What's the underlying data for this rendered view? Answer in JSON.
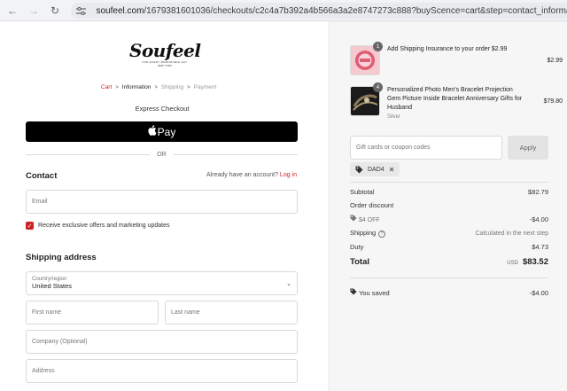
{
  "browser": {
    "url_host": "soufeel.com",
    "url_path": "/1679381601036/checkouts/c2c4a7b392a4b566a3a2e8747273c888?buyScence=cart&step=contact_information"
  },
  "brand": {
    "name": "Soufeel",
    "tagline": "FOR EVERY MEMORABLE DAY",
    "tagline2": "NEW YORK",
    "accent": "#cc2222"
  },
  "breadcrumb": {
    "cart": "Cart",
    "information": "Information",
    "shipping": "Shipping",
    "payment": "Payment",
    "separator": ">"
  },
  "express": {
    "title": "Express Checkout",
    "applepay_label": "Pay",
    "or_label": "OR"
  },
  "contact": {
    "title": "Contact",
    "account_prompt": "Already have an account?",
    "login_label": "Log in",
    "email_placeholder": "Email",
    "offers_label": "Receive exclusive offers and marketing updates"
  },
  "shipping": {
    "title": "Shipping address",
    "country_label": "Country/region",
    "country_value": "United States",
    "first_name_placeholder": "First name",
    "last_name_placeholder": "Last name",
    "company_placeholder": "Company (Optional)",
    "address_placeholder": "Address"
  },
  "cart": {
    "items": [
      {
        "qty": "1",
        "name": "Add Shipping Insurance to your order $2.99",
        "variant": "",
        "price": "$2.99"
      },
      {
        "qty": "4",
        "name": "Personalized Photo Men's Bracelet Projection Gem Picture Inside Bracelet Anniversary Gifts for Husband",
        "variant": "Silver",
        "price": "$79.80"
      }
    ],
    "coupon_placeholder": "Gift cards or coupon codes",
    "apply_label": "Apply",
    "applied_code": "DAD4"
  },
  "summary": {
    "subtotal_label": "Subtotal",
    "subtotal_value": "$82.79",
    "order_discount_label": "Order discount",
    "discount_code_label": "$4 OFF",
    "discount_value": "-$4.00",
    "shipping_label": "Shipping",
    "shipping_value": "Calculated in the next step",
    "duty_label": "Duty",
    "duty_value": "$4.73",
    "total_label": "Total",
    "currency": "USD",
    "total_value": "$83.52",
    "saved_label": "You saved",
    "saved_value": "-$4.00"
  }
}
